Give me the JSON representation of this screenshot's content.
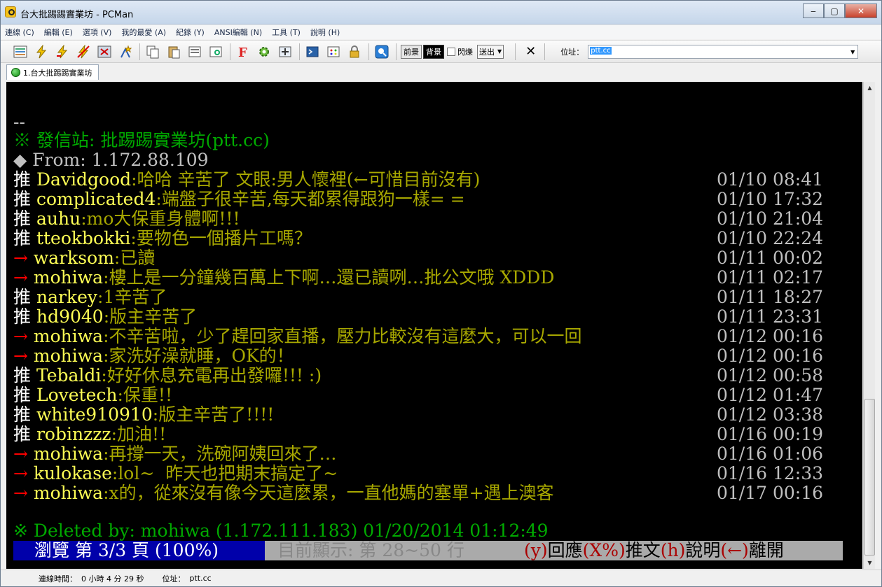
{
  "window": {
    "title": "台大批踢踢實業坊 - PCMan"
  },
  "menu": [
    "連線 (C)",
    "編輯 (E)",
    "選項 (V)",
    "我的最愛 (A)",
    "紀錄 (Y)",
    "ANSI編輯 (N)",
    "工具 (T)",
    "說明 (H)"
  ],
  "toolbar": {
    "fg_label": "前景",
    "bg_label": "背景",
    "blink_label": "閃爍",
    "send_label": "送出",
    "address_label": "位址：",
    "address_value": "ptt.cc"
  },
  "tab": {
    "label": "1.台大批踢踢實業坊"
  },
  "terminal": {
    "separator": "--",
    "origin_line": "※ 發信站: 批踢踢實業坊(ptt.cc)",
    "from_line": "◆ From: 1.172.88.109",
    "comments": [
      {
        "tag": "推",
        "user": "Davidgood",
        "text": ":哈哈 辛苦了 文眼:男人懷裡(←可惜目前沒有)",
        "time": "01/10 08:41"
      },
      {
        "tag": "推",
        "user": "complicated4",
        "text": ":端盤子很辛苦,每天都累得跟狗一樣= =",
        "time": "01/10 17:32"
      },
      {
        "tag": "推",
        "user": "auhu",
        "text": ":mo大保重身體啊!!!",
        "time": "01/10 21:04"
      },
      {
        "tag": "推",
        "user": "tteokbokki",
        "text": ":要物色一個播片工嗎？",
        "time": "01/10 22:24"
      },
      {
        "tag": "→",
        "user": "warksom",
        "text": ":已讀",
        "time": "01/11 00:02"
      },
      {
        "tag": "→",
        "user": "mohiwa",
        "text": ":樓上是一分鐘幾百萬上下啊…還已讀咧…批公文哦 XDDD",
        "time": "01/11 02:17"
      },
      {
        "tag": "推",
        "user": "narkey",
        "text": ":1辛苦了",
        "time": "01/11 18:27"
      },
      {
        "tag": "推",
        "user": "hd9040",
        "text": ":版主辛苦了",
        "time": "01/11 23:31"
      },
      {
        "tag": "→",
        "user": "mohiwa",
        "text": ":不辛苦啦，少了趕回家直播，壓力比較沒有這麼大，可以一回",
        "time": "01/12 00:16"
      },
      {
        "tag": "→",
        "user": "mohiwa",
        "text": ":家洗好澡就睡，OK的！",
        "time": "01/12 00:16"
      },
      {
        "tag": "推",
        "user": "Tebaldi",
        "text": ":好好休息充電再出發囉!!! :)",
        "time": "01/12 00:58"
      },
      {
        "tag": "推",
        "user": "Lovetech",
        "text": ":保重!!",
        "time": "01/12 01:47"
      },
      {
        "tag": "推",
        "user": "white910910",
        "text": ":版主辛苦了!!!!",
        "time": "01/12 03:38"
      },
      {
        "tag": "推",
        "user": "robinzzz",
        "text": ":加油!!",
        "time": "01/16 00:19"
      },
      {
        "tag": "→",
        "user": "mohiwa",
        "text": ":再撐一天，洗碗阿姨回來了…",
        "time": "01/16 01:06"
      },
      {
        "tag": "→",
        "user": "kulokase",
        "text": ":lol~  昨天也把期末搞定了~",
        "time": "01/16 12:33"
      },
      {
        "tag": "→",
        "user": "mohiwa",
        "text": ":x的，從來沒有像今天這麼累，一直他媽的塞單+遇上澳客",
        "time": "01/17 00:16"
      }
    ],
    "deleted_line": "※ Deleted by: mohiwa (1.172.111.183) 01/20/2014 01:12:49",
    "status": {
      "browse": "瀏覽 第 3/3 頁 (100%)",
      "showing": "目前顯示: 第 28~50 行",
      "k1": "(y)",
      "a1": "回應",
      "k2": "(X%)",
      "a2": "推文",
      "k3": "(h)",
      "a3": "說明",
      "k4": "(←)",
      "a4": "離開"
    }
  },
  "statusbar": {
    "conn_label": "連線時間：",
    "conn_value": "0 小時 4 分 29 秒",
    "addr_label": "位址：",
    "addr_value": "ptt.cc"
  },
  "colors": {
    "push": "#ffffff",
    "arrow": "#ff0000",
    "user": "#ffff55",
    "comment": "#a8a800",
    "origin": "#00aa00"
  }
}
